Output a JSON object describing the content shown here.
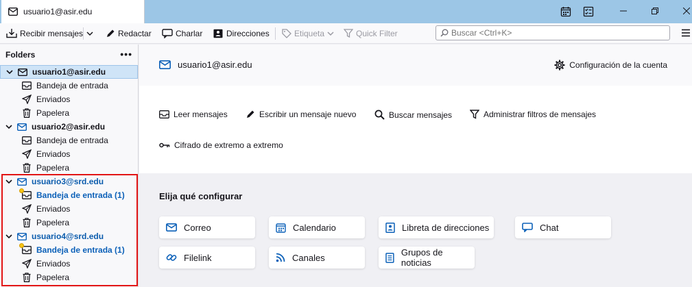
{
  "tab": {
    "title": "usuario1@asir.edu"
  },
  "window": {
    "calendar_icon": "calendar-icon",
    "tasks_icon": "tasks-icon",
    "minimize_icon": "minimize-icon",
    "maximize_icon": "maximize-icon",
    "close_icon": "close-icon"
  },
  "toolbar": {
    "get_messages": "Recibir mensajes",
    "write": "Redactar",
    "chat": "Charlar",
    "address_book": "Direcciones",
    "tag": "Etiqueta",
    "quick_filter": "Quick Filter",
    "search_placeholder": "Buscar <Ctrl+K>"
  },
  "folders": {
    "header": "Folders",
    "more": "•••",
    "tree": [
      {
        "label": "usuario1@asir.edu",
        "type": "account"
      },
      {
        "label": "Bandeja de entrada",
        "type": "inbox"
      },
      {
        "label": "Enviados",
        "type": "sent"
      },
      {
        "label": "Papelera",
        "type": "trash"
      },
      {
        "label": "usuario2@asir.edu",
        "type": "account"
      },
      {
        "label": "Bandeja de entrada",
        "type": "inbox"
      },
      {
        "label": "Enviados",
        "type": "sent"
      },
      {
        "label": "Papelera",
        "type": "trash"
      },
      {
        "label": "usuario3@srd.edu",
        "type": "account"
      },
      {
        "label": "Bandeja de entrada (1)",
        "type": "inbox"
      },
      {
        "label": "Enviados",
        "type": "sent"
      },
      {
        "label": "Papelera",
        "type": "trash"
      },
      {
        "label": "usuario4@srd.edu",
        "type": "account"
      },
      {
        "label": "Bandeja de entrada (1)",
        "type": "inbox"
      },
      {
        "label": "Enviados",
        "type": "sent"
      },
      {
        "label": "Papelera",
        "type": "trash"
      }
    ]
  },
  "account": {
    "title": "usuario1@asir.edu",
    "settings": "Configuración de la cuenta"
  },
  "actions": {
    "read": "Leer mensajes",
    "write": "Escribir un mensaje nuevo",
    "search": "Buscar mensajes",
    "filters": "Administrar filtros de mensajes",
    "e2e": "Cifrado de extremo a extremo"
  },
  "configure": {
    "title": "Elija qué configurar",
    "items": [
      "Correo",
      "Calendario",
      "Libreta de direcciones",
      "Chat",
      "Filelink",
      "Canales",
      "Grupos de noticias"
    ]
  },
  "colors": {
    "accent": "#0b60b8",
    "tabbar": "#9cc6e6",
    "highlight": "#e21414",
    "unread_dot": "#f7c514"
  }
}
